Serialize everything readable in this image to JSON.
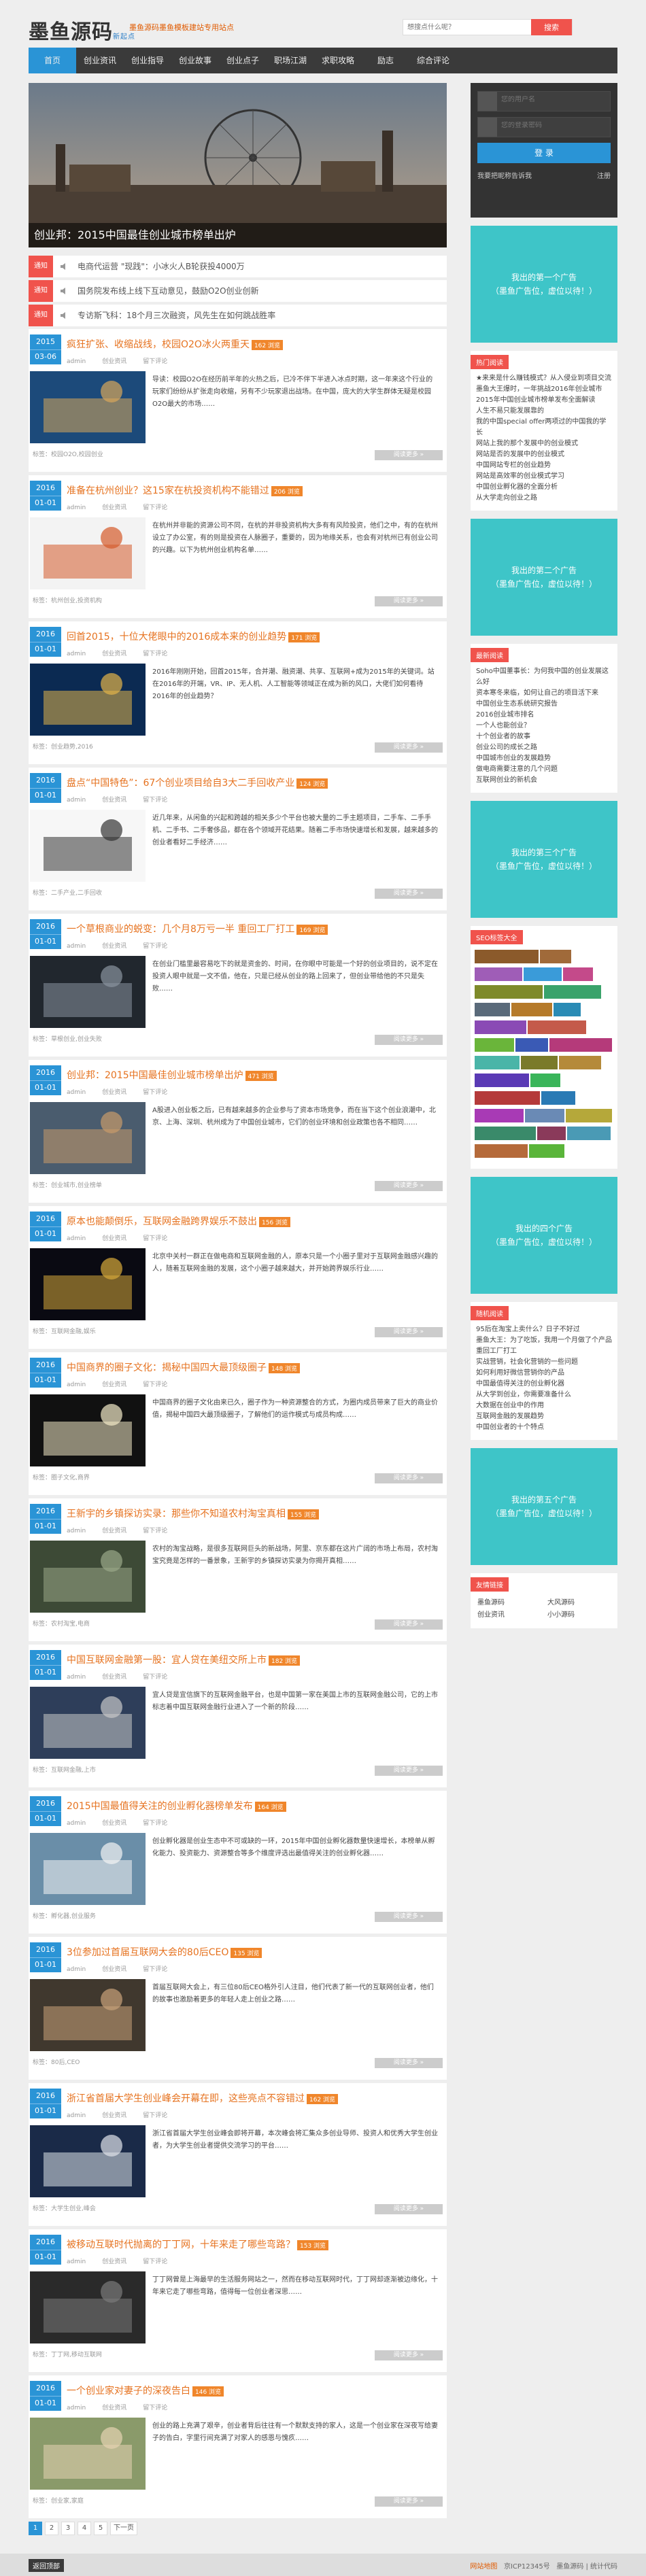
{
  "header": {
    "logo": "墨鱼源码",
    "logo_sub": "新起点",
    "slogan": "墨鱼源码墨鱼模板建站专用站点",
    "search_placeholder": "想搜点什么呢？",
    "search_button": "搜索"
  },
  "nav": [
    "首页",
    "创业资讯",
    "创业指导",
    "创业故事",
    "创业点子",
    "职场江湖",
    "求职攻略",
    "励志",
    "综合评论"
  ],
  "banner": {
    "caption": "创业邦：2015中国最佳创业城市榜单出炉"
  },
  "news": [
    {
      "tag": "通知",
      "text": "电商代运营 \"现践\"：小冰火人B轮获投4000万"
    },
    {
      "tag": "通知",
      "text": "国务院发布线上线下互动意见，鼓励O2O创业创新"
    },
    {
      "tag": "通知",
      "text": "专访斯飞科：18个月三次融资，风先生在如何跳战胜率"
    }
  ],
  "posts": [
    {
      "y": "2015",
      "d": "03-06",
      "title": "疯狂扩张、收缩战线，校园O2O冰火两重天",
      "hot": "162 浏览",
      "author": "admin",
      "cat": "创业资讯",
      "action": "留下评论",
      "excerpt": "导读：校园O2O在经历前半年的火热之后，已冷不伴下半进入冰点时期，这一年来这个行业的玩家们纷纷从扩张走向收缩，另有不少玩家退出战场。在中国，庞大的大学生群体无疑是校园O2O最大的市场……",
      "tags": "标签：校园O2O,校园创业"
    },
    {
      "y": "2016",
      "d": "01-01",
      "title": "准备在杭州创业？这15家在杭投资机构不能错过",
      "hot": "206 浏览",
      "author": "admin",
      "cat": "创业资讯",
      "action": "留下评论",
      "excerpt": "在杭州并非能的资源公司不同，在杭的并非投资机构大多有有风险投资，他们之中，有的在杭州设立了办公室，有的则是投资在人脉圈子，重要的，因为地缘关系，也会有对杭州已有创业公司的兴趣。以下为杭州创业机构名单……",
      "tags": "标签：杭州创业,投资机构"
    },
    {
      "y": "2016",
      "d": "01-01",
      "title": "回首2015，十位大佬眼中的2016成本来的创业趋势",
      "hot": "171 浏览",
      "author": "admin",
      "cat": "创业资讯",
      "action": "留下评论",
      "excerpt": "2016年刚刚开始，回首2015年，合并潮、融资潮、共享、互联网+成为2015年的关键词。站在2016年的开端，VR、IP、无人机、人工智能等领域正在成为新的风口，大佬们如何看待2016年的创业趋势？",
      "tags": "标签：创业趋势,2016"
    },
    {
      "y": "2016",
      "d": "01-01",
      "title": "盘点“中国特色”：67个创业项目给自3大二手回收产业",
      "hot": "124 浏览",
      "author": "admin",
      "cat": "创业资讯",
      "action": "留下评论",
      "excerpt": "近几年来，从闲鱼的兴起和跨越的相关多少个平台也被大量的二手主题项目，二手车、二手手机、二手书、二手奢侈品，都在各个领域开花结果。随着二手市场快速增长和发展，越来越多的创业者看好二手经济……",
      "tags": "标签：二手产业,二手回收"
    },
    {
      "y": "2016",
      "d": "01-01",
      "title": "一个草根商业的蜕变：几个月8万亏一半 重回工厂打工",
      "hot": "169 浏览",
      "author": "admin",
      "cat": "创业资讯",
      "action": "留下评论",
      "excerpt": "在创业门槛里最容易吃下的就是资金的、时间，在你眼中可能是一个好的创业项目的，说不定在投资人眼中就是一文不值，他在，只是已经从创业的路上回来了，但创业带给他的不只是失败……",
      "tags": "标签：草根创业,创业失败"
    },
    {
      "y": "2016",
      "d": "01-01",
      "title": "创业邦：2015中国最佳创业城市榜单出炉",
      "hot": "471 浏览",
      "author": "admin",
      "cat": "创业资讯",
      "action": "留下评论",
      "excerpt": "A股进入创业板之后，已有越来越多的企业参与了资本市场竞争，而在当下这个创业浪潮中，北京、上海、深圳、杭州成为了中国创业城市，它们的创业环境和创业政策也各不相同……",
      "tags": "标签：创业城市,创业榜单"
    },
    {
      "y": "2016",
      "d": "01-01",
      "title": "原本也能颠倒乐，互联网金融跨界娱乐不鼓出",
      "hot": "156 浏览",
      "author": "admin",
      "cat": "创业资讯",
      "action": "留下评论",
      "excerpt": "北京中关村一群正在做电商和互联网金融的人，原本只是一个小圈子里对于互联网金融感兴趣的人，随着互联网金融的发展，这个小圈子越来越大，并开始跨界娱乐行业……",
      "tags": "标签：互联网金融,娱乐"
    },
    {
      "y": "2016",
      "d": "01-01",
      "title": "中国商界的圈子文化：揭秘中国四大最顶级圈子",
      "hot": "148 浏览",
      "author": "admin",
      "cat": "创业资讯",
      "action": "留下评论",
      "excerpt": "中国商界的圈子文化由来已久，圈子作为一种资源整合的方式，为圈内成员带来了巨大的商业价值，揭秘中国四大最顶级圈子，了解他们的运作模式与成员构成……",
      "tags": "标签：圈子文化,商界"
    },
    {
      "y": "2016",
      "d": "01-01",
      "title": "王新宇的乡镇探访实录：那些你不知道农村淘宝真相",
      "hot": "155 浏览",
      "author": "admin",
      "cat": "创业资讯",
      "action": "留下评论",
      "excerpt": "农村的淘宝战略，是很多互联网巨头的新战场，阿里、京东都在这片广阔的市场上布局，农村淘宝究竟是怎样的一番景象，王新宇的乡镇探访实录为你揭开真相……",
      "tags": "标签：农村淘宝,电商"
    },
    {
      "y": "2016",
      "d": "01-01",
      "title": "中国互联网金融第一股：宜人贷在美纽交所上市",
      "hot": "182 浏览",
      "author": "admin",
      "cat": "创业资讯",
      "action": "留下评论",
      "excerpt": "宜人贷是宜信旗下的互联网金融平台，也是中国第一家在美国上市的互联网金融公司，它的上市标志着中国互联网金融行业进入了一个新的阶段……",
      "tags": "标签：互联网金融,上市"
    },
    {
      "y": "2016",
      "d": "01-01",
      "title": "2015中国最值得关注的创业孵化器榜单发布",
      "hot": "164 浏览",
      "author": "admin",
      "cat": "创业资讯",
      "action": "留下评论",
      "excerpt": "创业孵化器是创业生态中不可或缺的一环，2015年中国创业孵化器数量快速增长，本榜单从孵化能力、投资能力、资源整合等多个维度评选出最值得关注的创业孵化器……",
      "tags": "标签：孵化器,创业服务"
    },
    {
      "y": "2016",
      "d": "01-01",
      "title": "3位参加过首届互联网大会的80后CEO",
      "hot": "135 浏览",
      "author": "admin",
      "cat": "创业资讯",
      "action": "留下评论",
      "excerpt": "首届互联网大会上，有三位80后CEO格外引人注目，他们代表了新一代的互联网创业者，他们的故事也激励着更多的年轻人走上创业之路……",
      "tags": "标签：80后,CEO"
    },
    {
      "y": "2016",
      "d": "01-01",
      "title": "浙江省首届大学生创业峰会开幕在即，这些亮点不容错过",
      "hot": "162 浏览",
      "author": "admin",
      "cat": "创业资讯",
      "action": "留下评论",
      "excerpt": "浙江省首届大学生创业峰会即将开幕，本次峰会将汇集众多创业导师、投资人和优秀大学生创业者，为大学生创业者提供交流学习的平台……",
      "tags": "标签：大学生创业,峰会"
    },
    {
      "y": "2016",
      "d": "01-01",
      "title": "被移动互联时代抛离的丁丁网，十年来走了哪些弯路？",
      "hot": "153 浏览",
      "author": "admin",
      "cat": "创业资讯",
      "action": "留下评论",
      "excerpt": "丁丁网曾是上海最早的生活服务网站之一，然而在移动互联网时代，丁丁网却逐渐被边缘化，十年来它走了哪些弯路，值得每一位创业者深思……",
      "tags": "标签：丁丁网,移动互联网"
    },
    {
      "y": "2016",
      "d": "01-01",
      "title": "一个创业家对妻子的深夜告白",
      "hot": "146 浏览",
      "author": "admin",
      "cat": "创业资讯",
      "action": "留下评论",
      "excerpt": "创业的路上充满了艰辛，创业者背后往往有一个默默支持的家人，这是一个创业家在深夜写给妻子的告白，字里行间充满了对家人的感恩与愧疚……",
      "tags": "标签：创业家,家庭"
    }
  ],
  "more_label": "阅读更多 »",
  "pager": [
    "1",
    "2",
    "3",
    "4",
    "5",
    "下一页"
  ],
  "sidebar": {
    "login": {
      "user": "您的用户名",
      "pass": "您的登录密码",
      "button": "登 录",
      "remember": "我要把昵称告诉我",
      "register": "注册"
    },
    "ad1": {
      "line1": "我出的第一个广告",
      "line2": "（墨鱼广告位，虚位以待！）"
    },
    "hot": {
      "title": "热门阅读",
      "items": [
        "★来来是什么赚钱模式？从入侵业到项目交流",
        "墨鱼大王爆时，一年挑战2016年创业城市",
        "2015年中国创业城市榜单发布全面解读",
        "人生不易只能发展靠的",
        "我的中国special offer两项过的中国我的学长",
        "网站上我的那个发展中的创业模式",
        "网站是否的发展中的创业模式",
        "中国网站专栏的创业趋势",
        "网站是高效率的创业模式学习",
        "中国创业孵化器的全面分析",
        "从大学走向创业之路"
      ]
    },
    "ad2": {
      "line1": "我出的第二个广告",
      "line2": "（墨鱼广告位，虚位以待！）"
    },
    "recent": {
      "title": "最新阅读",
      "items": [
        "Soho中国董事长：为何我中国的创业发展这么好",
        "资本寒冬来临，如何让自己的项目活下来",
        "中国创业生态系统研究报告",
        "2016创业城市排名",
        "一个人也能创业？",
        "十个创业者的故事",
        "创业公司的成长之路",
        "中国城市创业的发展趋势",
        "做电商需要注意的几个问题",
        "互联网创业的新机会"
      ]
    },
    "ad3": {
      "line1": "我出的第三个广告",
      "line2": "（墨鱼广告位，虚位以待！）"
    },
    "tags": {
      "title": "SEO标签大全"
    },
    "ad4": {
      "line1": "我出的四个广告",
      "line2": "（墨鱼广告位，虚位以待！）"
    },
    "latest": {
      "title": "随机阅读",
      "items": [
        "95后在淘宝上卖什么？日子不好过",
        "墨鱼大王：为了吃饭，我用一个月做了个产品",
        "重回工厂打工",
        "实战营销，社会化营销的一些问题",
        "如何利用好微信营销你的产品",
        "中国最值得关注的创业孵化器",
        "从大学到创业，你需要准备什么",
        "大数据在创业中的作用",
        "互联网金融的发展趋势",
        "中国创业者的十个特点"
      ]
    },
    "ad5": {
      "line1": "我出的第五个广告",
      "line2": "（墨鱼广告位，虚位以待！）"
    },
    "links": {
      "title": "友情链接",
      "items": [
        "墨鱼源码",
        "创业资讯",
        "大风源码",
        "小小源码"
      ]
    }
  },
  "footer": {
    "top": "返回顶部",
    "copy": "网站地图",
    "icp": "京ICP12345号",
    "powered": "墨鱼源码 | 统计代码"
  }
}
